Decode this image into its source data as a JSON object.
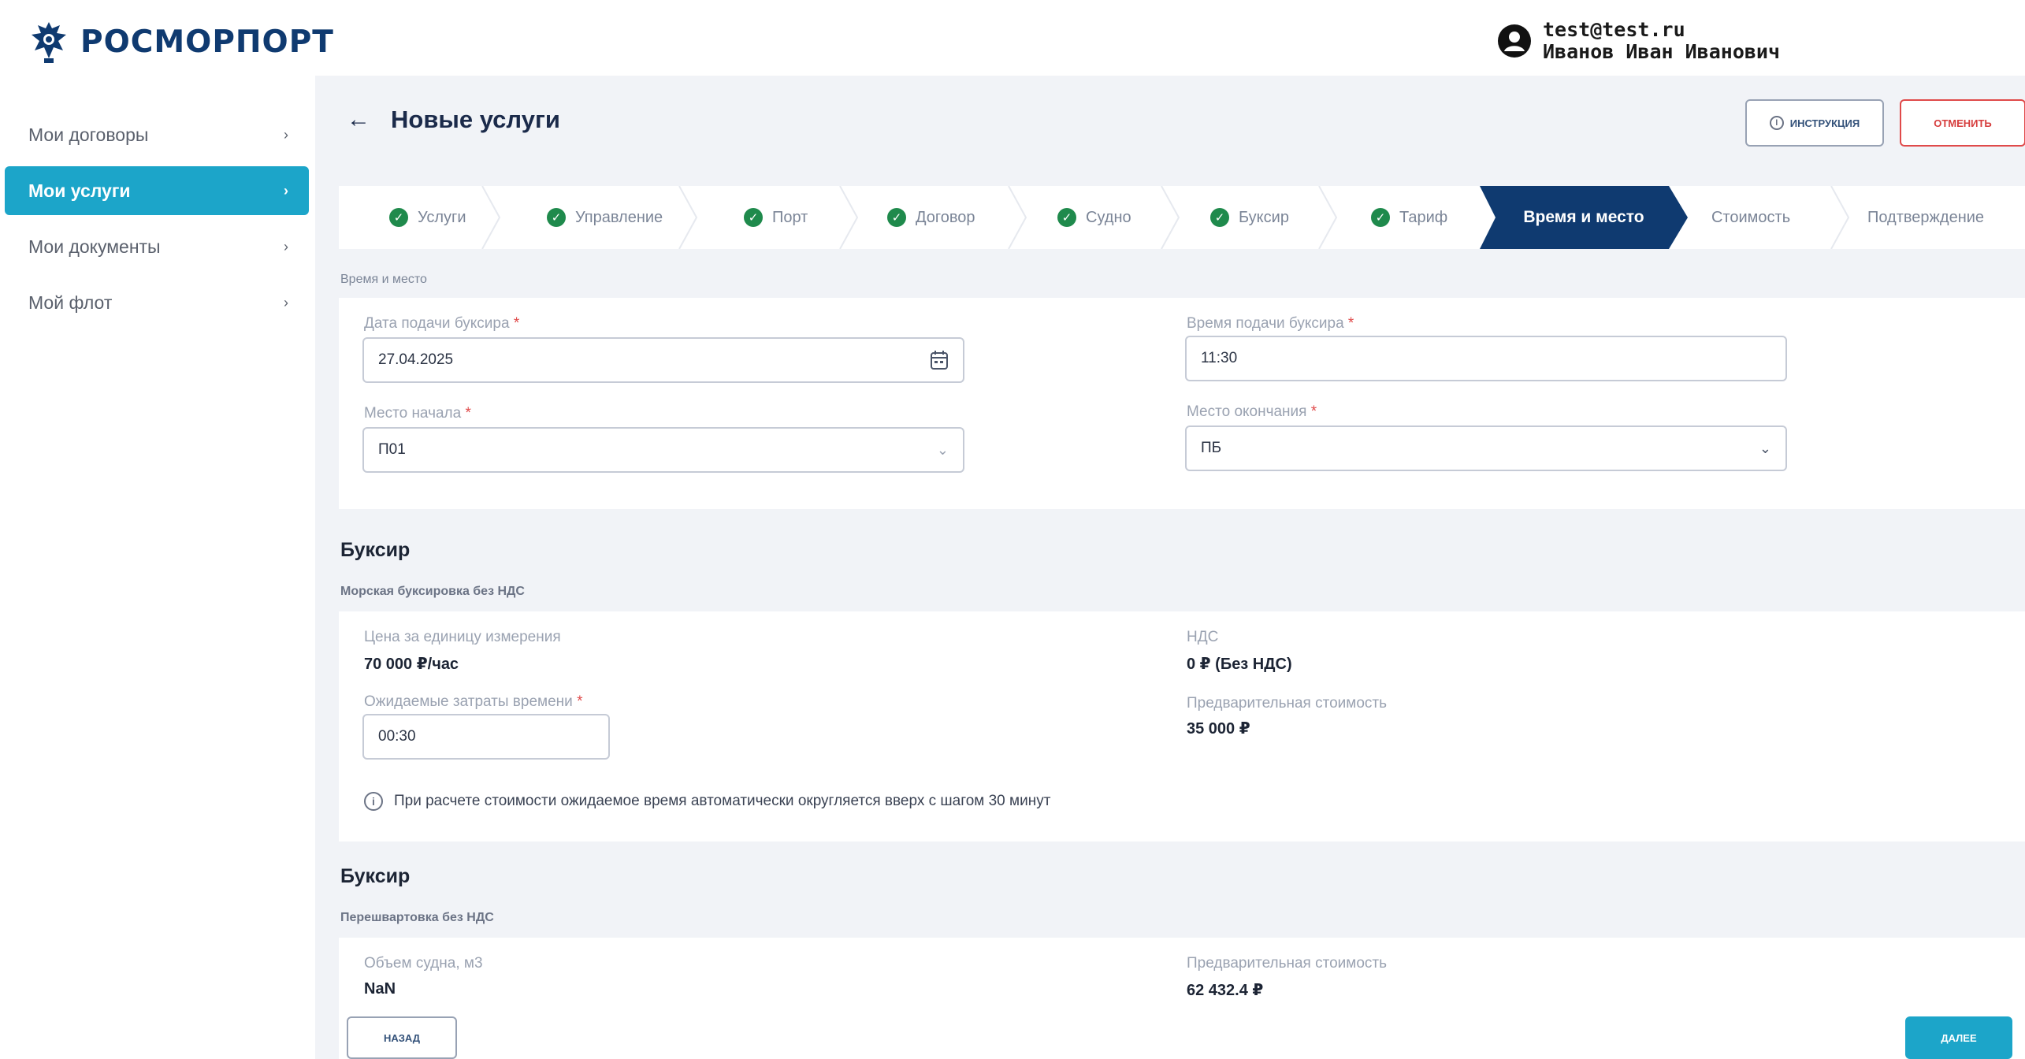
{
  "header": {
    "logo_text": "РОСМОРПОРТ",
    "user_email": "test@test.ru",
    "user_name": "Иванов Иван Иванович"
  },
  "sidebar": {
    "items": [
      {
        "label": "Мои договоры",
        "active": false
      },
      {
        "label": "Мои услуги",
        "active": true
      },
      {
        "label": "Мои документы",
        "active": false
      },
      {
        "label": "Мой флот",
        "active": false
      }
    ]
  },
  "page": {
    "title": "Новые услуги",
    "instructions_label": "Инструкция",
    "cancel_label": "Отменить",
    "back_label": "Назад",
    "next_label": "Далее"
  },
  "stepper": {
    "steps": [
      {
        "label": "Услуги",
        "state": "done"
      },
      {
        "label": "Управление",
        "state": "done"
      },
      {
        "label": "Порт",
        "state": "done"
      },
      {
        "label": "Договор",
        "state": "done"
      },
      {
        "label": "Судно",
        "state": "done"
      },
      {
        "label": "Буксир",
        "state": "done"
      },
      {
        "label": "Тариф",
        "state": "done"
      },
      {
        "label": "Время и место",
        "state": "active"
      },
      {
        "label": "Стоимость",
        "state": "pending"
      },
      {
        "label": "Подтверждение",
        "state": "pending"
      }
    ]
  },
  "time_place": {
    "caption": "Время и место",
    "date_label": "Дата подачи буксира",
    "date_value": "27.04.2025",
    "time_label": "Время подачи буксира",
    "time_value": "11:30",
    "start_label": "Место начала",
    "start_value": "П01",
    "end_label": "Место окончания",
    "end_value": "ПБ"
  },
  "tug1": {
    "title": "Буксир",
    "subtitle": "Морская буксировка без НДС",
    "price_label": "Цена за единицу измерения",
    "price_value": "70 000 ₽/час",
    "vat_label": "НДС",
    "vat_value": "0 ₽ (Без НДС)",
    "expected_time_label": "Ожидаемые затраты времени",
    "expected_time_value": "00:30",
    "prelim_cost_label": "Предварительная стоимость",
    "prelim_cost_value": "35 000 ₽",
    "info_text": "При расчете стоимости ожидаемое время автоматически округляется вверх с шагом 30 минут"
  },
  "tug2": {
    "title": "Буксир",
    "subtitle": "Перешвартовка без НДС",
    "volume_label": "Объем судна, м3",
    "volume_value": "NaN",
    "prelim_cost_label": "Предварительная стоимость",
    "prelim_cost_value": "62 432.4 ₽"
  },
  "colors": {
    "accent": "#1ca5c9",
    "active_step": "#0f3a70",
    "done_check": "#1f8a4c",
    "cancel": "#e04a4a"
  }
}
